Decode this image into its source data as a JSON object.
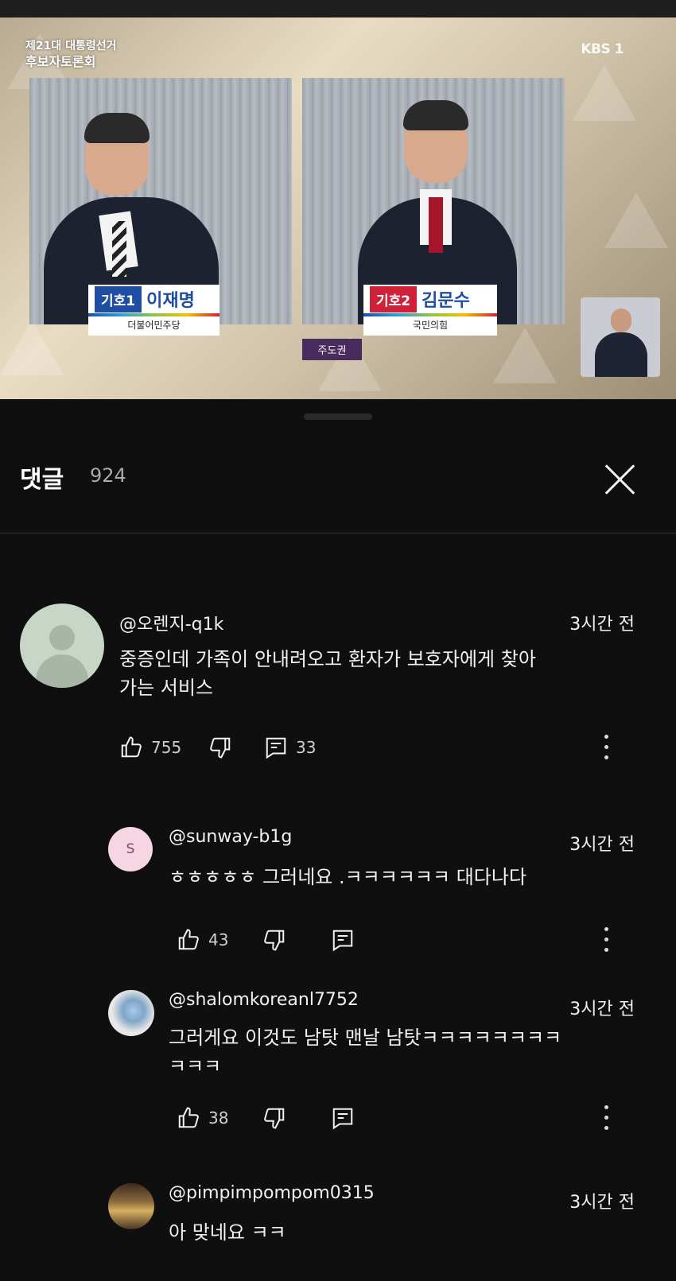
{
  "video": {
    "program_line1": "제21대 대통령선거",
    "program_line2": "후보자토론회",
    "broadcaster": "KBS 1",
    "candidate1": {
      "number": "기호1",
      "name": "이재명",
      "party": "더불어민주당"
    },
    "candidate2": {
      "number": "기호2",
      "name": "김문수",
      "party": "국민의힘"
    },
    "speaker_tag": "주도권"
  },
  "comments_sheet": {
    "title": "댓글",
    "count": "924"
  },
  "comments": [
    {
      "handle": "@오렌지-q1k",
      "time": "3시간 전",
      "text_line1": "중증인데  가족이  안내려오고 환자가  보호자에게 찾아",
      "text_line2": "가는 서비스",
      "likes": "755",
      "replies": "33"
    },
    {
      "handle": "@sunway-b1g",
      "time": "3시간 전",
      "avatar_letter": "S",
      "text_line1": "ㅎㅎㅎㅎㅎ 그러네요 .ㅋㅋㅋㅋㅋㅋ 대다나다",
      "likes": "43"
    },
    {
      "handle": "@shalomkoreanl7752",
      "time": "3시간 전",
      "text_line1": "그러게요 이것도 남탓 맨날 남탓ㅋㅋㅋㅋㅋㅋㅋㅋ",
      "text_line2": "ㅋㅋㅋ",
      "likes": "38"
    },
    {
      "handle": "@pimpimpompom0315",
      "time": "3시간 전",
      "text_line1": "아 맞네요 ㅋㅋ"
    }
  ]
}
